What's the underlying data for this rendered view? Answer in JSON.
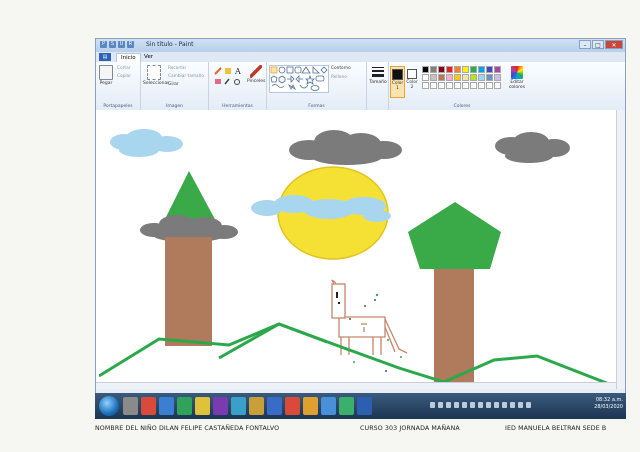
{
  "window": {
    "title": "Sin título - Paint",
    "quick_access": [
      "P",
      "S",
      "U",
      "R"
    ],
    "buttons": {
      "minimize": "–",
      "maximize": "□",
      "close": "✕"
    }
  },
  "ribbon": {
    "file_tab": "▤",
    "tabs": [
      "Inicio",
      "Ver"
    ],
    "active_tab": "Inicio",
    "portapapeles": {
      "paste": "Pegar",
      "cut": "Cortar",
      "copy": "Copiar",
      "group_label": "Portapapeles"
    },
    "imagen": {
      "select": "Seleccionar",
      "crop": "Recortar",
      "resize": "Cambiar tamaño",
      "rotate": "Girar",
      "group_label": "Imagen"
    },
    "herramientas": {
      "brushes": "Pinceles",
      "group_label": "Herramientas"
    },
    "formas": {
      "outline": "Contorno",
      "fill": "Relleno",
      "group_label": "Formas"
    },
    "size": "Tamaño",
    "color1": "Color 1",
    "color2": "Color 2",
    "edit_colors": "Editar colores",
    "colores_label": "Colores",
    "palette": [
      "#000000",
      "#7f7f7f",
      "#880015",
      "#ed1c24",
      "#ff7f27",
      "#fff200",
      "#22b14c",
      "#00a2e8",
      "#3f48cc",
      "#a349a4",
      "#ffffff",
      "#c3c3c3",
      "#b97a57",
      "#ffaec9",
      "#ffc90e",
      "#efe4b0",
      "#b5e61d",
      "#99d9ea",
      "#7092be",
      "#c8bfe7",
      "#ffffff",
      "#ffffff",
      "#ffffff",
      "#ffffff",
      "#ffffff",
      "#ffffff",
      "#ffffff",
      "#ffffff",
      "#ffffff",
      "#ffffff"
    ]
  },
  "taskbar": {
    "time": "08:32 a.m.",
    "date": "28/03/2020",
    "app_colors": [
      "#8a8a8a",
      "#d94a3a",
      "#3a7fd1",
      "#2fa35a",
      "#e0c23a",
      "#7a3ab0",
      "#3aa0c8",
      "#c8a03a",
      "#3a6bc8",
      "#d94a3a",
      "#e0a030",
      "#4a90d9",
      "#3ab06a",
      "#2d5fb0"
    ]
  },
  "footer": {
    "student": "NOMBRE DEL NIÑO  DILAN FELIPE CASTAÑEDA FONTALVO",
    "course": "CURSO    303  JORNADA  MAÑANA",
    "school": "IED   MANUELA BELTRAN  SEDE B"
  },
  "colors": {
    "sky_cloud": "#a9d6ef",
    "gray_cloud": "#7b7b7b",
    "sun": "#f5e133",
    "tree_green": "#3aaa48",
    "trunk": "#b07a5c",
    "grass_line": "#2aa84a"
  }
}
